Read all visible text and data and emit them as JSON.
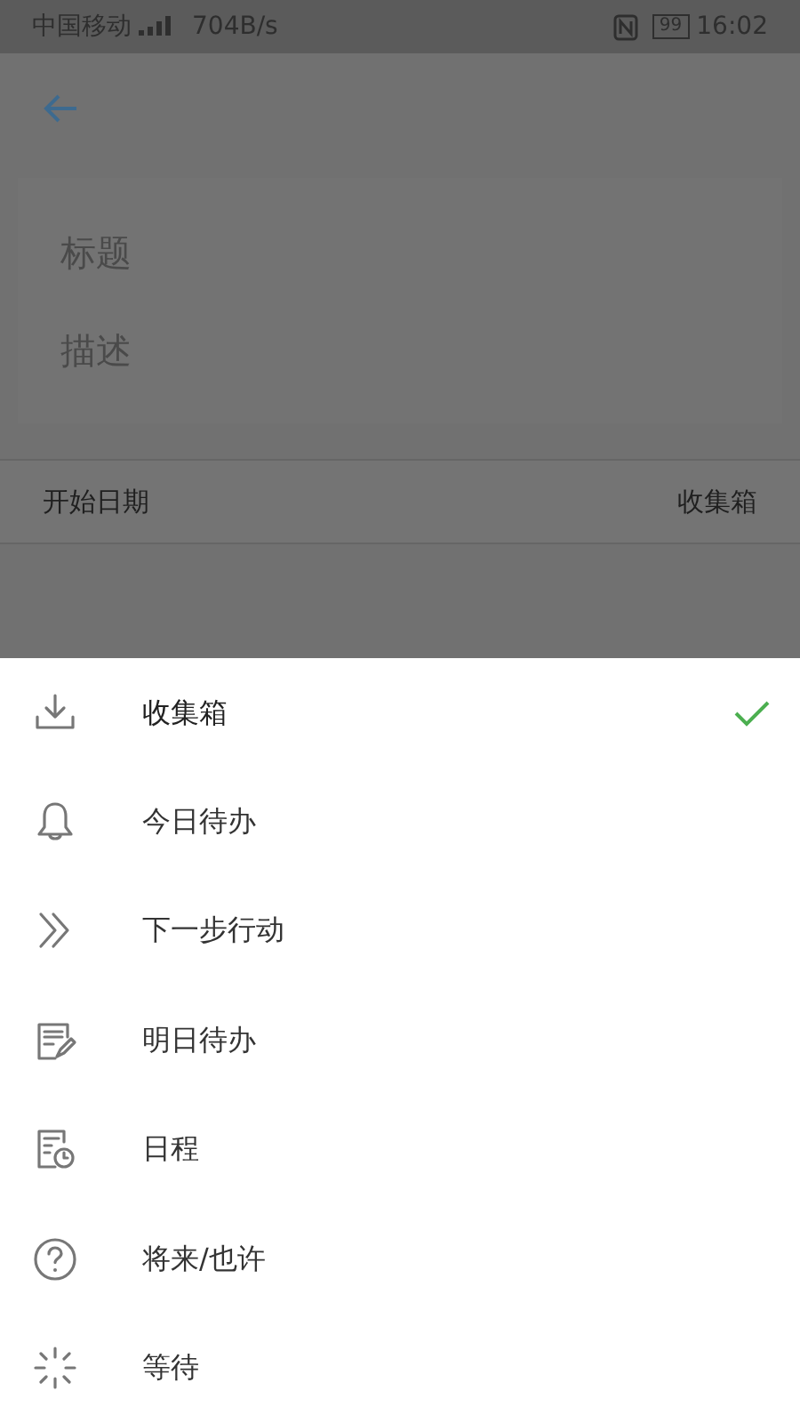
{
  "status_bar": {
    "carrier": "中国移动",
    "speed": "704B/s",
    "battery": "99",
    "time": "16:02"
  },
  "form": {
    "title": {
      "placeholder": "标题"
    },
    "description": {
      "placeholder": "描述"
    },
    "start_row": {
      "label": "开始日期",
      "value": "收集箱"
    }
  },
  "sheet": {
    "items": [
      {
        "label": "收集箱",
        "kind": "inbox",
        "selected": true
      },
      {
        "label": "今日待办",
        "kind": "bell",
        "selected": false
      },
      {
        "label": "下一步行动",
        "kind": "chevrons",
        "selected": false
      },
      {
        "label": "明日待办",
        "kind": "note",
        "selected": false
      },
      {
        "label": "日程",
        "kind": "schedule",
        "selected": false
      },
      {
        "label": "将来/也许",
        "kind": "question",
        "selected": false
      },
      {
        "label": "等待",
        "kind": "wait",
        "selected": false
      }
    ]
  }
}
